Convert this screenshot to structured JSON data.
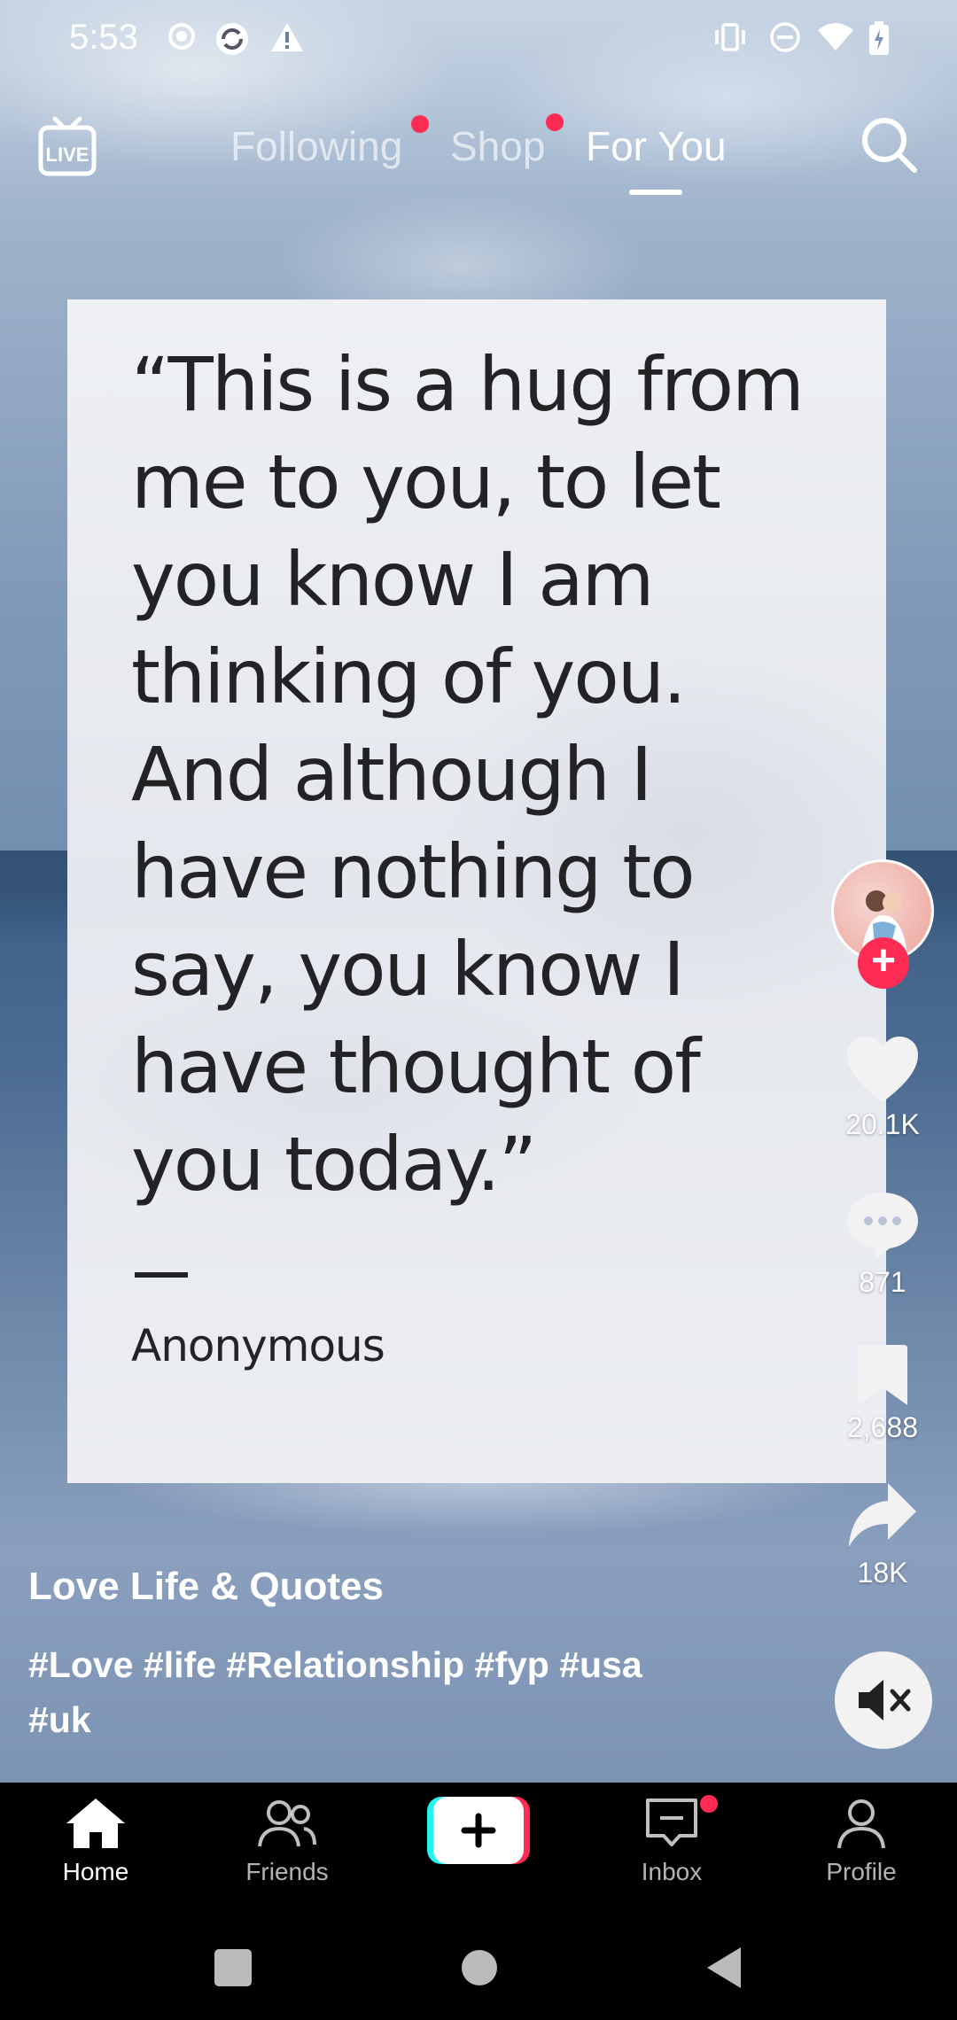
{
  "status_bar": {
    "time": "5:53",
    "left_icons": [
      "record-icon",
      "sync-icon",
      "warning-icon"
    ],
    "right_icons": [
      "vibrate-icon",
      "do-not-disturb-icon",
      "wifi-icon",
      "battery-charging-icon"
    ]
  },
  "top_nav": {
    "live_label": "LIVE",
    "tabs": [
      {
        "label": "Following",
        "active": false,
        "has_dot": true
      },
      {
        "label": "Shop",
        "active": false,
        "has_dot": true
      },
      {
        "label": "For You",
        "active": true,
        "has_dot": false
      }
    ]
  },
  "post": {
    "quote_lines": [
      "“This is a hug from",
      "me to you, to let",
      "you know I am",
      "thinking of you.",
      "And although I",
      "have nothing to",
      "say, you know I",
      "have thought of",
      "you today.”"
    ],
    "dash": "—",
    "author": "Anonymous",
    "username": "Love Life & Quotes",
    "hashtags": "#Love #life #Relationship #fyp #usa #uk"
  },
  "actions": {
    "likes": "20.1K",
    "comments": "871",
    "saves": "2,688",
    "shares": "18K"
  },
  "bottom_nav": {
    "items": [
      {
        "label": "Home",
        "icon": "home-icon",
        "active": true
      },
      {
        "label": "Friends",
        "icon": "friends-icon",
        "active": false
      },
      {
        "label": "",
        "icon": "create-plus-icon",
        "active": false
      },
      {
        "label": "Inbox",
        "icon": "inbox-icon",
        "active": false,
        "has_dot": true
      },
      {
        "label": "Profile",
        "icon": "profile-icon",
        "active": false
      }
    ]
  },
  "colors": {
    "accent_red": "#fe2c55",
    "create_cyan": "#25f4ee",
    "nav_background": "#000000"
  }
}
